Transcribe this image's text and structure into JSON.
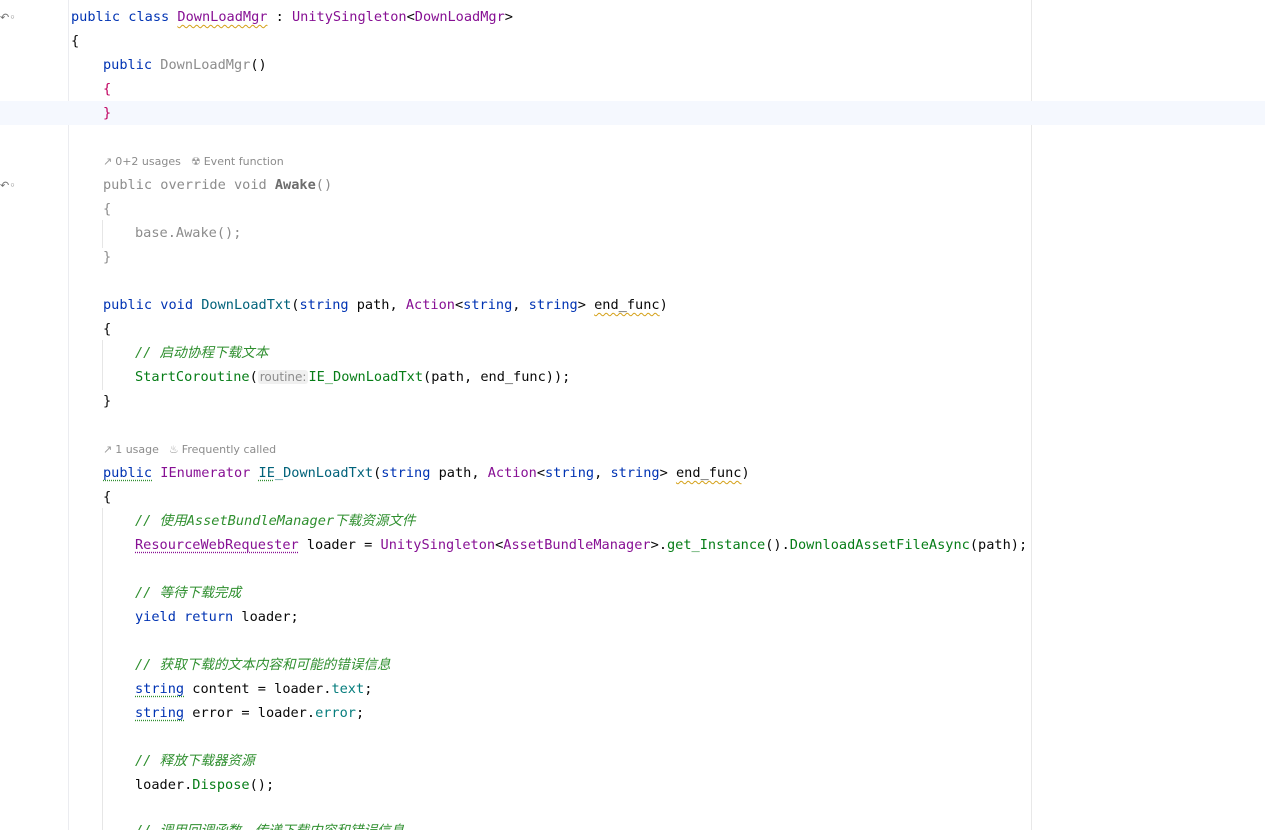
{
  "editor": {
    "hints": {
      "awake_usages": "0+2 usages",
      "awake_tag": "Event function",
      "ie_usages": "1 usage",
      "ie_tag": "Frequently called",
      "param_routine": "routine:"
    },
    "tokens": {
      "public": "public",
      "class": "class",
      "class_name": "DownLoadMgr",
      "colon": " : ",
      "base_class": "UnitySingleton",
      "lt": "<",
      "gt": ">",
      "open_brace": "{",
      "close_brace": "}",
      "ctor_name": "DownLoadMgr",
      "parens": "()",
      "override_sig": "public override void ",
      "awake": "Awake",
      "base_awake": "base.Awake();",
      "void": "void",
      "download_txt": "DownLoadTxt",
      "lparen": "(",
      "rparen": ")",
      "string": "string",
      "path_param": " path, ",
      "action": "Action",
      "comma": ", ",
      "end_func": "end_func",
      "comment_start_coroutine": "// 启动协程下载文本",
      "start_coroutine": "StartCoroutine",
      "ie_download_txt": "IE_DownLoadTxt",
      "call_args": "(path, end_func));",
      "ienumerator": "IEnumerator",
      "ie_prefix": "IE",
      "ie_suffix": "_DownLoadTxt",
      "comment_use_prefix": "// 使用",
      "asset_bundle_manager": "AssetBundleManager",
      "comment_use_suffix": "下载资源文件",
      "resource_requester": "ResourceWebRequester",
      "loader_assign": " loader = ",
      "unity_singleton": "UnitySingleton",
      "dot": ".",
      "get_instance": "get_Instance",
      "call_empty": "()",
      "download_asset": "DownloadAssetFileAsync",
      "path_call": "(path);",
      "comment_wait": "// 等待下载完成",
      "yield": "yield",
      "return": "return",
      "loader_semicolon": " loader;",
      "comment_get": "// 获取下载的文本内容和可能的错误信息",
      "content_assign": " content = loader.",
      "text": "text",
      "semicolon": ";",
      "error_assign": " error = loader.",
      "error": "error",
      "comment_release": "// 释放下载器资源",
      "loader_dot": "loader.",
      "dispose": "Dispose",
      "dispose_call": "();",
      "comment_callback": "// 调用回调函数，传递下载内容和错误信息"
    }
  }
}
